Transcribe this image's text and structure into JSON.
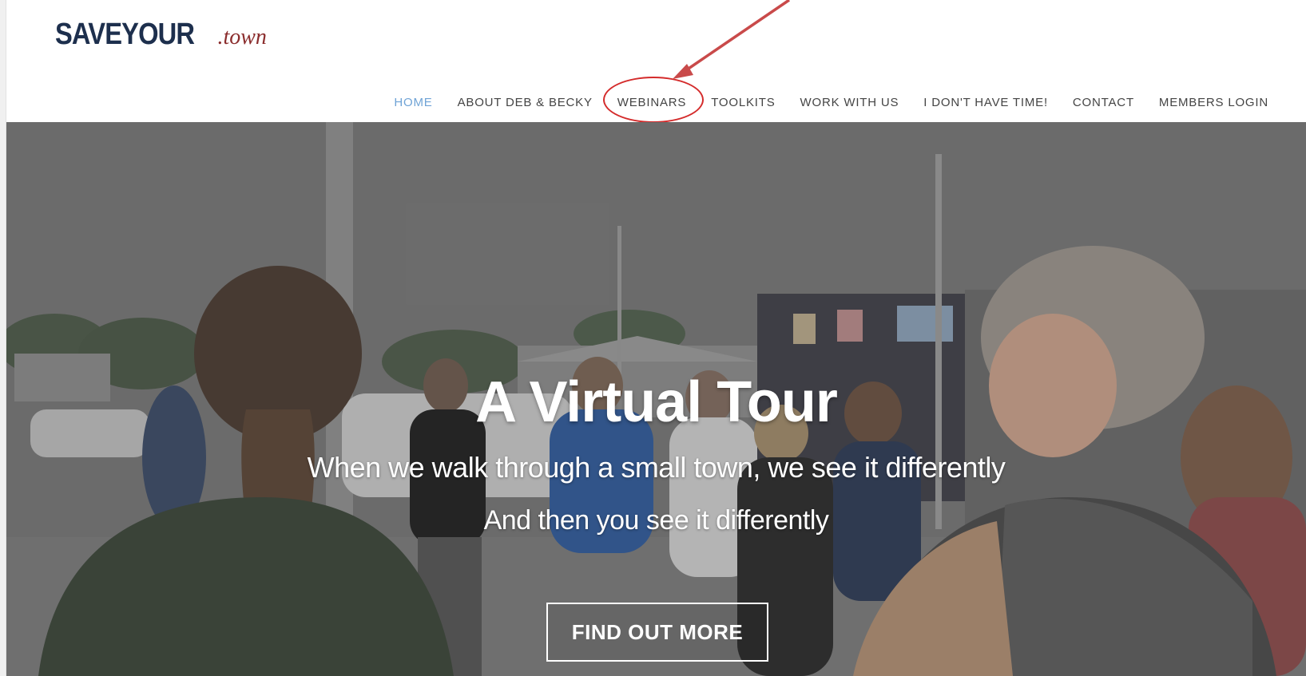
{
  "logo": {
    "main": "SAVEYOUR",
    "suffix": ".town"
  },
  "nav": {
    "items": [
      {
        "label": "HOME",
        "active": true
      },
      {
        "label": "ABOUT DEB & BECKY",
        "active": false
      },
      {
        "label": "WEBINARS",
        "active": false,
        "highlighted": true
      },
      {
        "label": "TOOLKITS",
        "active": false
      },
      {
        "label": "WORK WITH US",
        "active": false
      },
      {
        "label": "I DON'T HAVE TIME!",
        "active": false
      },
      {
        "label": "CONTACT",
        "active": false
      },
      {
        "label": "MEMBERS LOGIN",
        "active": false
      }
    ]
  },
  "hero": {
    "title": "A Virtual Tour",
    "subtitle": "When we walk through a small town, we see it differently",
    "subtitle_2": "And then you see it differently",
    "cta_label": "FIND OUT MORE"
  },
  "colors": {
    "logo_navy": "#1d2f4d",
    "logo_red": "#8b2d2d",
    "nav_active": "#6fa3d6",
    "nav_text": "#444444",
    "annotation_red": "#d42b2b"
  }
}
